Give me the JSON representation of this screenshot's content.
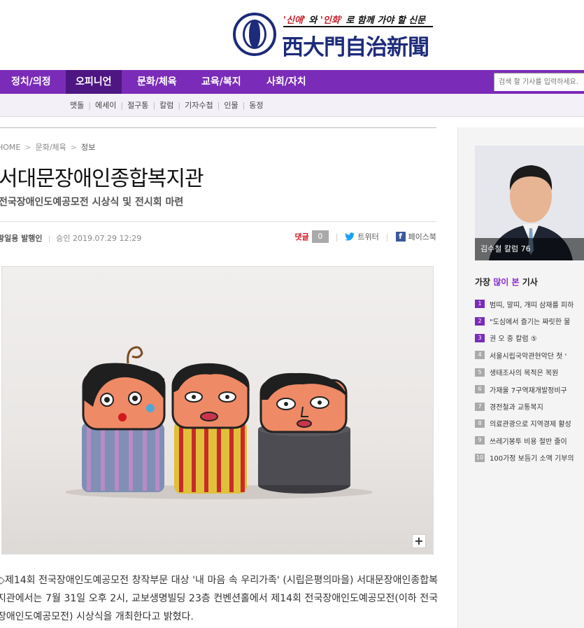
{
  "masthead": {
    "tagline_quote1": "'신애'",
    "tagline_mid": " 와 ",
    "tagline_quote2": "'인화'",
    "tagline_tail": " 로 함께 가야 할 신문",
    "title": "西大門自治新聞"
  },
  "nav": {
    "items": [
      "정치/의정",
      "오피니언",
      "문화/체육",
      "교육/복지",
      "사회/자치"
    ],
    "active": "오피니언",
    "search_placeholder": "검색 할 기사를 입력하세요."
  },
  "subnav": {
    "items": [
      "맷돌",
      "에세이",
      "절구통",
      "칼럼",
      "기자수첩",
      "인물",
      "동정"
    ]
  },
  "article": {
    "breadcrumb": [
      "HOME",
      "문화/체육",
      "정보"
    ],
    "headline": "서대문장애인종합복지관",
    "subheadline": "전국장애인도예공모전 시상식 및 전시회 마련",
    "author": "황일용 발행인",
    "approved_label": "승인",
    "approved_time": "2019.07.29 12:29",
    "comment_label": "댓글",
    "comment_count": "0",
    "twitter_label": "트위터",
    "facebook_label": "페이스북",
    "zoom_label": "+",
    "body": "◇제14회 전국장애인도예공모전 창작부문 대상 '내 마음 속 우리가족' (시립은평의마을) 서대문장애인종합복지관에서는 7월 31일 오후 2시, 교보생명빌딩 23층 컨벤션홀에서 제14회 전국장애인도예공모전(이하 전국장애인도예공모전) 시상식을 개최한다고 밝혔다."
  },
  "sidebar": {
    "column_caption": "김수철 칼럼 76",
    "popular_prefix": "가장 ",
    "popular_highlight": "많이 본",
    "popular_suffix": " 기사",
    "popular": [
      "범띠, 말띠, 개띠 삼재를 피하",
      "\"도심에서 즐기는 짜릿한 물",
      "권 오 중 칼럼 ⑤",
      "서울시립국악관현악단 첫 '",
      "생태조사의 목적은 복원",
      "가재울 7구역재개발정비구",
      "경전철과 교통복지",
      "의료관광으로 지역경제 활성",
      "쓰레기봉투 비용 절반 줄이",
      "100가정 보듬기 소액 기부의"
    ]
  },
  "colors": {
    "nav_purple": "#7a2cb8",
    "nav_active": "#4e1682",
    "logo_navy": "#1c2b7a",
    "accent_red": "#c6202a"
  }
}
